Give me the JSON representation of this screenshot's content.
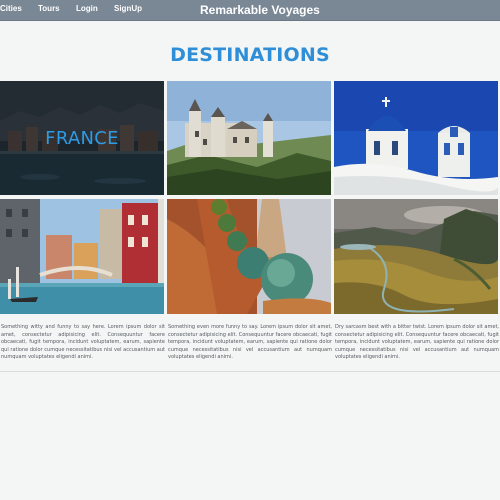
{
  "navbar": {
    "links": [
      "Cities",
      "Tours",
      "Login",
      "SignUp"
    ],
    "brand": "Remarkable Voyages",
    "background": "#7a8795"
  },
  "page": {
    "heading": "DESTINATIONS",
    "accent": "#2e8fd8"
  },
  "destinations": [
    {
      "label": "FRANCE",
      "image": "france-coast-town-photo"
    },
    {
      "label": "",
      "image": "hilltop-castle-photo"
    },
    {
      "label": "",
      "image": "white-blue-dome-church-photo"
    },
    {
      "label": "",
      "image": "colorful-canal-city-photo"
    },
    {
      "label": "",
      "image": "mosaic-spire-ceramic-photo"
    },
    {
      "label": "",
      "image": "green-highland-valley-photo"
    }
  ],
  "descriptions": [
    "Something witty and funny to say here. Lorem ipsum dolor sit amet, consectetur adipisicing elit. Consequuntur facere obcaecati, fugit tempora, incidunt voluptatem, earum, sapiente qui ratione dolor cumque necessitatibus nisi vel accusantium aut numquam voluptates eligendi animi.",
    "Something even more funny to say. Lorem ipsum dolor sit amet, consectetur adipisicing elit. Consequuntur facere obcaecati, fugit tempora, incidunt voluptatem, earum, sapiente qui ratione dolor cumque necessitatibus nisi vel accusantium aut numquam voluptates eligendi animi.",
    "Dry sarcasm best with a bitter twist. Lorem ipsum dolor sit amet, consectetur adipisicing elit. Consequuntur facere obcaecati, fugit tempora, incidunt voluptatem, earum, sapiente qui ratione dolor cumque necessitatibus nisi vel accusantium aut numquam voluptates eligendi animi."
  ]
}
